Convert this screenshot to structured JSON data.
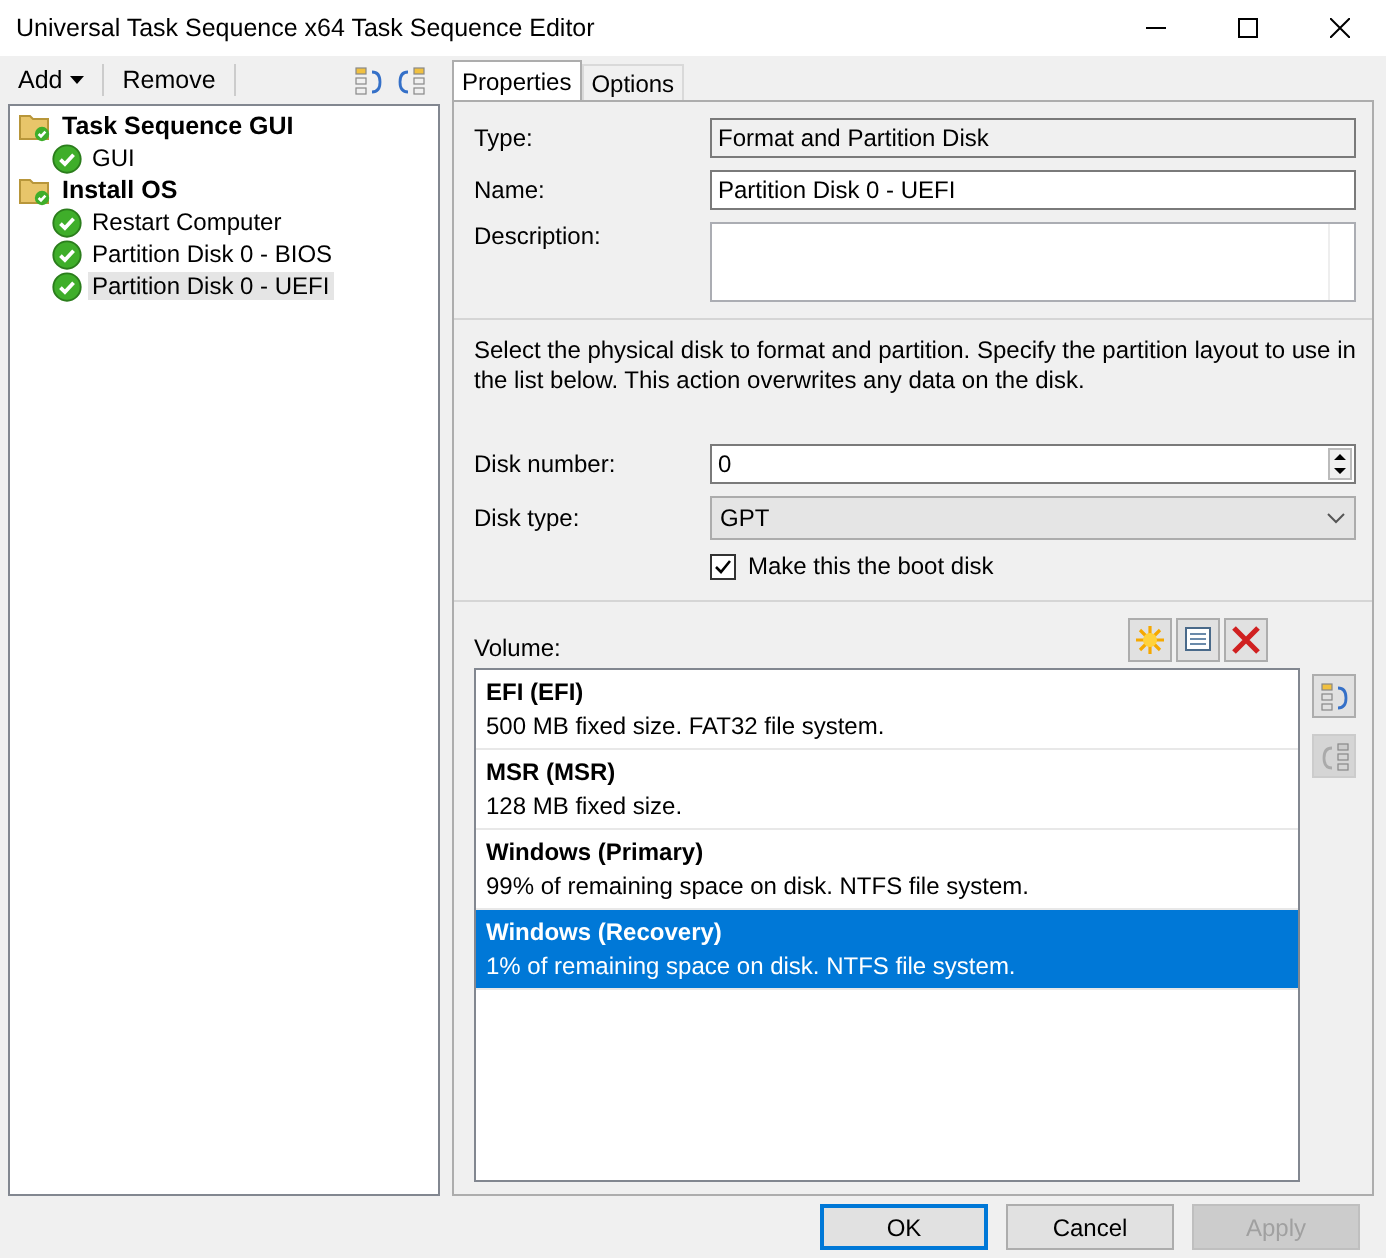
{
  "window": {
    "title": "Universal Task Sequence x64 Task Sequence Editor"
  },
  "toolbar": [
    {
      "kind": "menu",
      "label": "Add"
    },
    {
      "kind": "button",
      "label": "Remove"
    }
  ],
  "tree": [
    {
      "label": "Task Sequence GUI",
      "kind": "group",
      "selected": false,
      "children": [
        {
          "label": "GUI",
          "kind": "step",
          "selected": false
        }
      ]
    },
    {
      "label": "Install OS",
      "kind": "group",
      "selected": false,
      "children": [
        {
          "label": "Restart Computer",
          "kind": "step",
          "selected": false
        },
        {
          "label": "Partition Disk 0 - BIOS",
          "kind": "step",
          "selected": false
        },
        {
          "label": "Partition Disk 0 - UEFI",
          "kind": "step",
          "selected": true
        }
      ]
    }
  ],
  "tabs": [
    {
      "label": "Properties",
      "selected": true
    },
    {
      "label": "Options",
      "selected": false
    }
  ],
  "type": {
    "label": "Type:",
    "value": "Format and Partition Disk"
  },
  "name": {
    "label": "Name:",
    "value": "Partition Disk 0 - UEFI"
  },
  "description": {
    "label": "Description:"
  },
  "instructions": "Select the physical disk to format and partition. Specify the partition layout to use in the list below. This action overwrites any data on the disk.",
  "disk_number": {
    "label": "Disk number:",
    "value": "0"
  },
  "disk_type": {
    "label": "Disk type:",
    "value": "GPT"
  },
  "boot_disk": {
    "label": "Make this the boot disk",
    "checked": true
  },
  "volume_label": "Volume:",
  "volumes": [
    {
      "name": "EFI (EFI)",
      "detail": "500 MB fixed size. FAT32 file system.",
      "selected": false
    },
    {
      "name": "MSR (MSR)",
      "detail": "128 MB fixed size.",
      "selected": false
    },
    {
      "name": "Windows (Primary)",
      "detail": "99% of remaining space on disk. NTFS file system.",
      "selected": false
    },
    {
      "name": "Windows (Recovery)",
      "detail": "1% of remaining space on disk. NTFS file system.",
      "selected": true
    }
  ],
  "move_buttons": [
    {
      "disabled": false
    },
    {
      "disabled": true
    }
  ],
  "buttons": [
    {
      "label": "OK",
      "disabled": false
    },
    {
      "label": "Cancel",
      "disabled": false
    },
    {
      "label": "Apply",
      "disabled": true
    }
  ]
}
